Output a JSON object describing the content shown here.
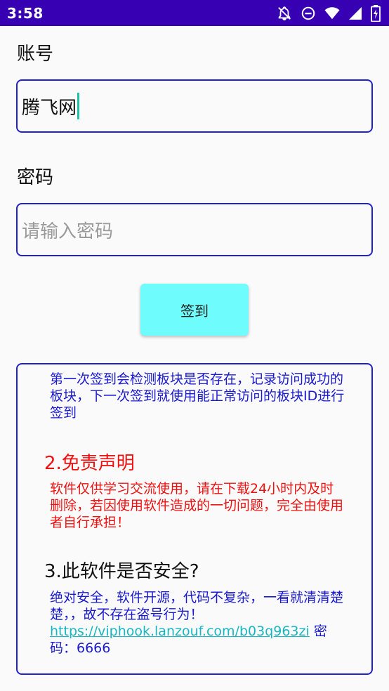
{
  "status_bar": {
    "time": "3:58",
    "icons": [
      "notifications-off-icon",
      "do-not-disturb-icon",
      "wifi-icon",
      "signal-icon",
      "battery-icon"
    ]
  },
  "form": {
    "account_label": "账号",
    "account_value": "腾飞网",
    "password_label": "密码",
    "password_placeholder": "请输入密码",
    "signin_label": "签到"
  },
  "info": {
    "paragraph_1": "第一次签到会检测板块是否存在，记录访问成功的板块，下一次签到就使用能正常访问的板块ID进行签到",
    "heading_2": "2.免责声明",
    "paragraph_2": "软件仅供学习交流使用，请在下载24小时内及时删除，若因使用软件造成的一切问题，完全由使用者自行承担！",
    "heading_3": "3.此软件是否安全?",
    "paragraph_3": "绝对安全，软件开源，代码不复杂，一看就清清楚楚，，故不存在盗号行为！",
    "link_text": "https://viphook.lanzouf.com/b03q963zi",
    "password_note": " 密码：6666"
  },
  "colors": {
    "status_bar": "#3700b3",
    "border": "#2222cc",
    "button": "#6ffcfc",
    "blue_text": "#1a1ad0",
    "red_text": "#ee1111",
    "link": "#17b6c0"
  }
}
